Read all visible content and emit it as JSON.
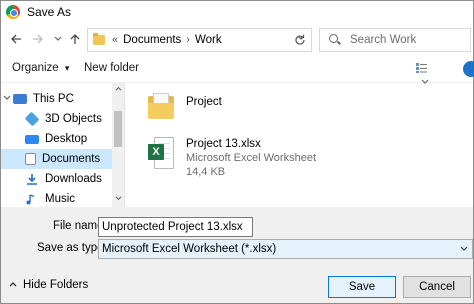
{
  "window": {
    "title": "Save As"
  },
  "nav": {
    "back_icon": "left-arrow",
    "forward_icon": "right-arrow",
    "recent_icon": "chevron-down",
    "up_icon": "up-arrow",
    "breadcrumb_prefix": "«",
    "path": [
      "Documents",
      "Work"
    ],
    "path_separator": "›",
    "refresh_icon": "refresh",
    "search_placeholder": "Search Work"
  },
  "toolbar": {
    "organize_label": "Organize",
    "organize_caret": "▾",
    "new_folder_label": "New folder"
  },
  "sidebar": {
    "items": [
      {
        "label": "This PC",
        "icon": "pc-icon",
        "color": "#3a7bd5"
      },
      {
        "label": "3D Objects",
        "icon": "cube-icon",
        "color": "#4aa3df"
      },
      {
        "label": "Desktop",
        "icon": "desktop-icon",
        "color": "#2d89ef"
      },
      {
        "label": "Documents",
        "icon": "documents-icon",
        "color": "#8a8a8a"
      },
      {
        "label": "Downloads",
        "icon": "download-icon",
        "color": "#1e72c8"
      },
      {
        "label": "Music",
        "icon": "music-icon",
        "color": "#1e72c8"
      }
    ]
  },
  "files": [
    {
      "name": "Project",
      "type": "folder",
      "details": []
    },
    {
      "name": "Project 13.xlsx",
      "type": "excel",
      "details": [
        "Microsoft Excel Worksheet",
        "14,4 KB"
      ]
    }
  ],
  "form": {
    "filename_label": "File name:",
    "filename_value": "Unprotected Project 13.xlsx",
    "savetype_label": "Save as type:",
    "savetype_value": "Microsoft Excel Worksheet (*.xlsx)"
  },
  "footer": {
    "hide_folders_label": "Hide Folders",
    "save_label": "Save",
    "cancel_label": "Cancel"
  },
  "colors": {
    "selection": "#cce8ff",
    "accent": "#0078d7",
    "excel": "#1f7244",
    "folder": "#f5cd5e"
  }
}
